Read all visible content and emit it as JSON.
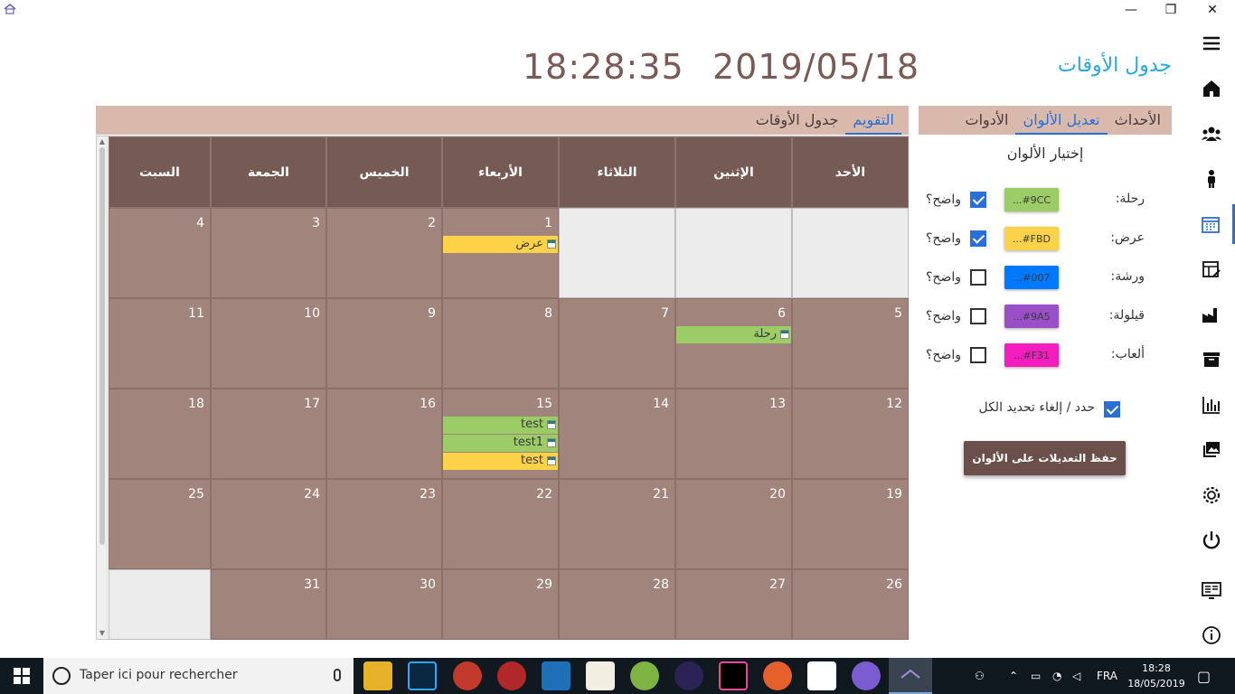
{
  "window": {
    "app_icon": "house-schedule-icon",
    "minimize": "—",
    "restore": "❐",
    "close": "✕"
  },
  "header": {
    "title": "جدول الأوقات",
    "date": "2019/05/18",
    "time": "18:28:35"
  },
  "left_tabs": [
    "الأحداث",
    "تعديل الألوان",
    "الأدوات"
  ],
  "left_tabs_active": 1,
  "calendar_tabs": [
    "التقويم",
    "جدول الأوقات"
  ],
  "calendar_tabs_active": 0,
  "colors_panel": {
    "title": "إختيار الألوان",
    "visible_label": "واضح؟",
    "rows": [
      {
        "label": "رحلة:",
        "hex": "...#9CC",
        "color": "#9bcc66",
        "visible": true
      },
      {
        "label": "عرض:",
        "hex": "...#FBD",
        "color": "#fbd248",
        "visible": true
      },
      {
        "label": "ورشة:",
        "hex": "...#007",
        "color": "#0078ff",
        "visible": false
      },
      {
        "label": "قيلولة:",
        "hex": "...#9A5",
        "color": "#9a4fc8",
        "visible": false
      },
      {
        "label": "ألعاب:",
        "hex": "...#F31",
        "color": "#f31ebd",
        "visible": false
      }
    ],
    "select_all_label": "حدد / إلغاء تحديد الكل",
    "select_all_checked": true,
    "save_label": "حفظ التعديلات على الألوان"
  },
  "calendar": {
    "day_names": [
      "الأحد",
      "الإثنين",
      "الثلاثاء",
      "الأربعاء",
      "الخميس",
      "الجمعة",
      "السبت"
    ],
    "weeks": [
      [
        "",
        "",
        "",
        "1",
        "2",
        "3",
        "4"
      ],
      [
        "5",
        "6",
        "7",
        "8",
        "9",
        "10",
        "11"
      ],
      [
        "12",
        "13",
        "14",
        "15",
        "16",
        "17",
        "18"
      ],
      [
        "19",
        "20",
        "21",
        "22",
        "23",
        "24",
        "25"
      ],
      [
        "26",
        "27",
        "28",
        "29",
        "30",
        "31",
        ""
      ]
    ],
    "events": [
      {
        "week": 0,
        "day": 3,
        "title": "عرض",
        "color": "#fbd248"
      },
      {
        "week": 1,
        "day": 1,
        "title": "رحلة",
        "color": "#9bcc66"
      },
      {
        "week": 2,
        "day": 3,
        "title": "test",
        "color": "#9bcc66"
      },
      {
        "week": 2,
        "day": 3,
        "title": "test1",
        "color": "#9bcc66"
      },
      {
        "week": 2,
        "day": 3,
        "title": "test",
        "color": "#fbd248"
      }
    ]
  },
  "nav_icons": [
    "hamburger-menu-icon",
    "home-icon",
    "group-icon",
    "person-icon",
    "calendar-icon",
    "edit-table-icon",
    "factory-icon",
    "archive-icon",
    "bar-chart-icon",
    "image-gallery-icon",
    "settings-gear-icon",
    "power-icon",
    "presentation-icon",
    "info-icon"
  ],
  "nav_active": 4,
  "taskbar": {
    "search_placeholder": "Taper ici pour rechercher",
    "language": "FRA",
    "clock_time": "18:28",
    "clock_date": "18/05/2019"
  }
}
